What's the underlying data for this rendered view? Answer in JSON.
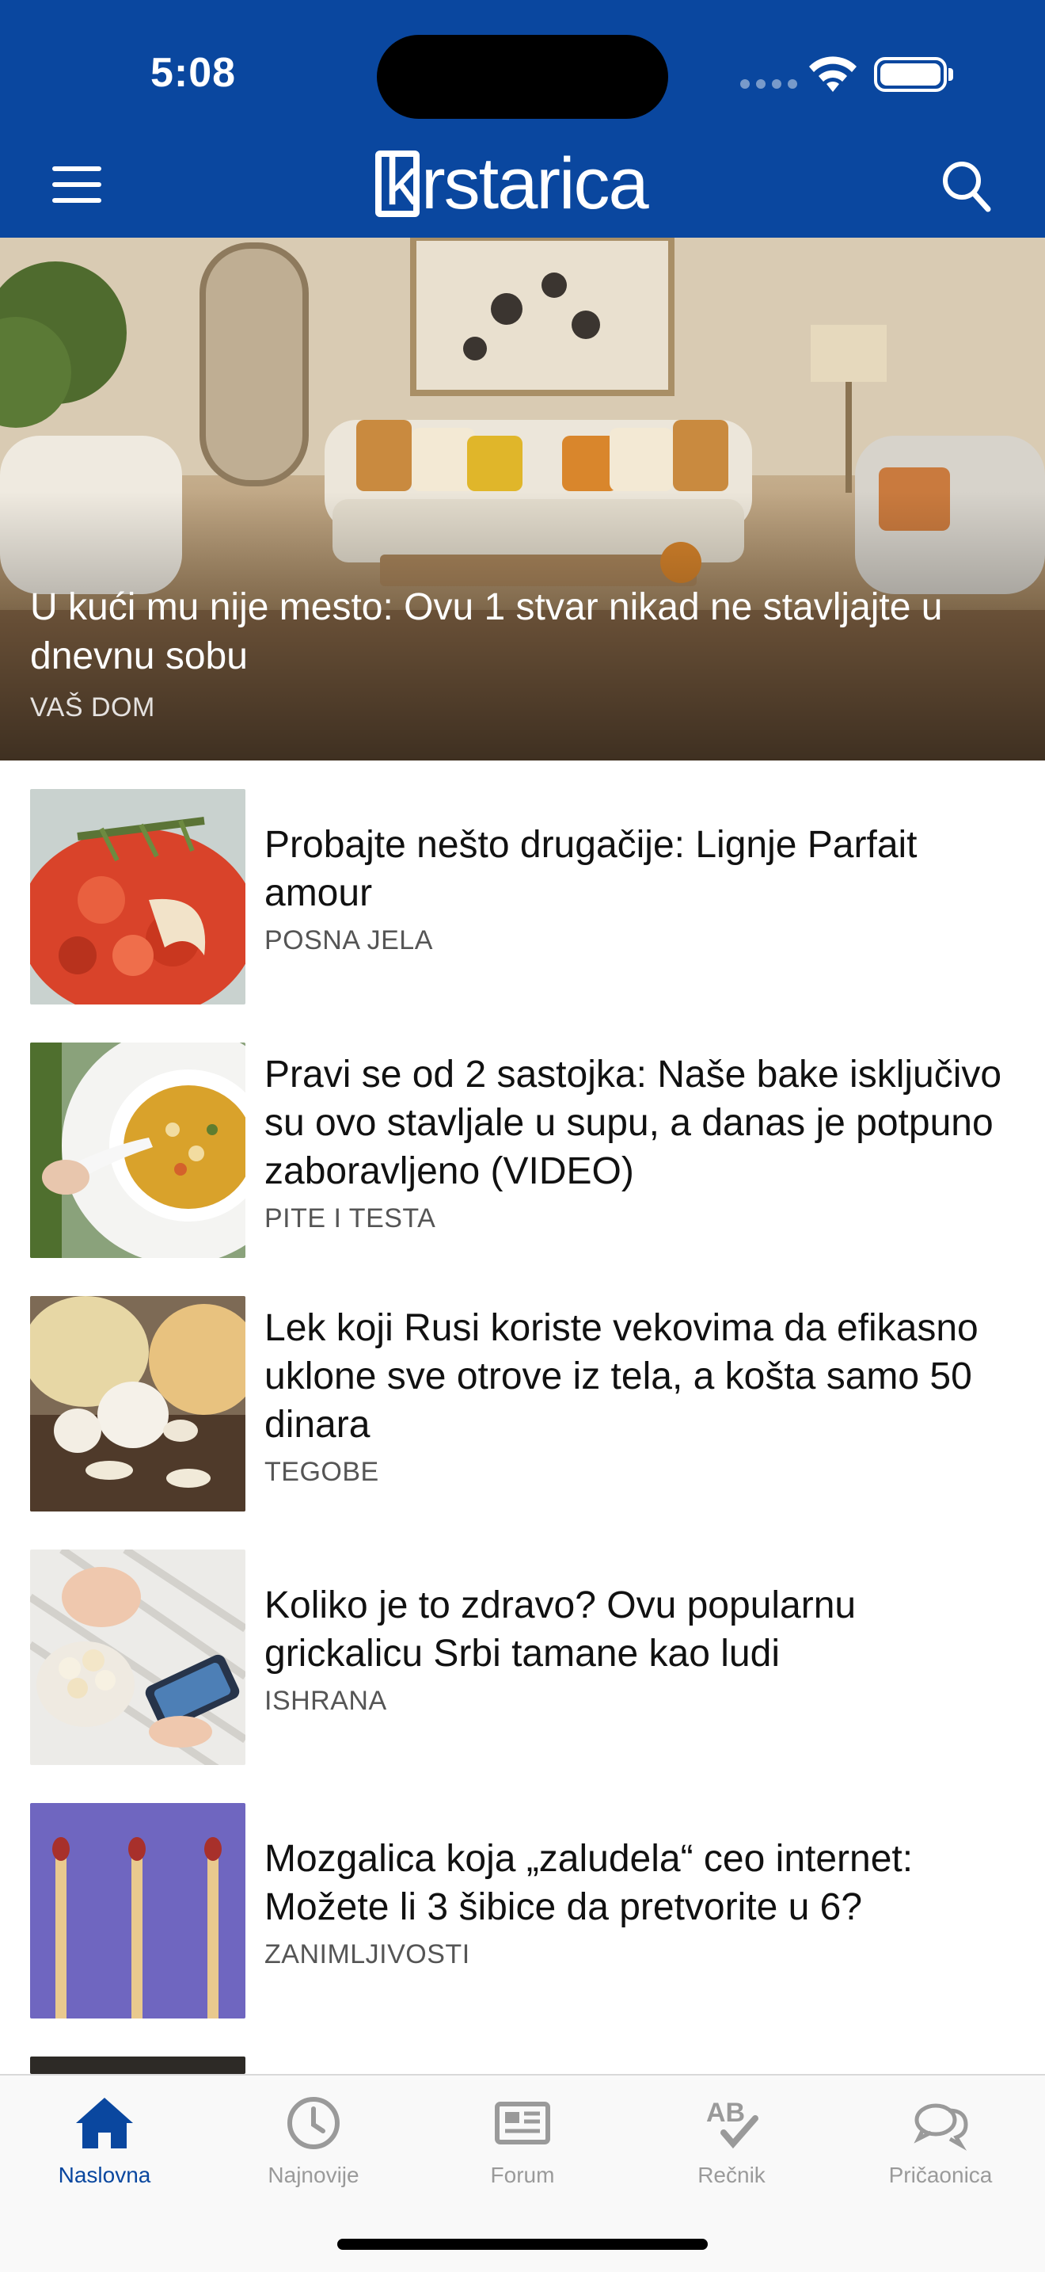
{
  "status_bar": {
    "time": "5:08"
  },
  "header": {
    "logo_text": "rstarica",
    "logo_k": "k",
    "brand_color": "#0a479f"
  },
  "hero": {
    "title": "U kući mu nije mesto: Ovu 1 stvar nikad ne stavljajte u dnevnu sobu",
    "category": "VAŠ DOM"
  },
  "articles": [
    {
      "title": "Probajte nešto drugačije: Lignje Parfait amour",
      "category": "POSNA JELA",
      "image": "squid-dish-icon"
    },
    {
      "title": "Pravi se od 2 sastojka: Naše bake isključivo su ovo stavljale u supu, a danas je potpuno zaboravljeno (VIDEO)",
      "category": "PITE I TESTA",
      "image": "soup-bowl-icon"
    },
    {
      "title": "Lek koji Rusi koriste vekovima da efikasno uklone sve otrove iz tela, a košta samo 50 dinara",
      "category": "TEGOBE",
      "image": "onion-garlic-icon"
    },
    {
      "title": "Koliko je to zdravo? Ovu popularnu grickalicu Srbi tamane kao ludi",
      "category": "ISHRANA",
      "image": "popcorn-icon"
    },
    {
      "title": "Mozgalica koja „zaludela“ ceo internet: Možete li 3 šibice da pretvorite u 6?",
      "category": "ZANIMLJIVOSTI",
      "image": "matches-icon"
    }
  ],
  "tabbar": {
    "tabs": [
      {
        "label": "Naslovna",
        "icon": "home-icon",
        "active": true
      },
      {
        "label": "Najnovije",
        "icon": "clock-icon",
        "active": false
      },
      {
        "label": "Forum",
        "icon": "newspaper-icon",
        "active": false
      },
      {
        "label": "Rečnik",
        "icon": "dictionary-check-icon",
        "active": false
      },
      {
        "label": "Pričaonica",
        "icon": "chat-bubbles-icon",
        "active": false
      }
    ]
  }
}
